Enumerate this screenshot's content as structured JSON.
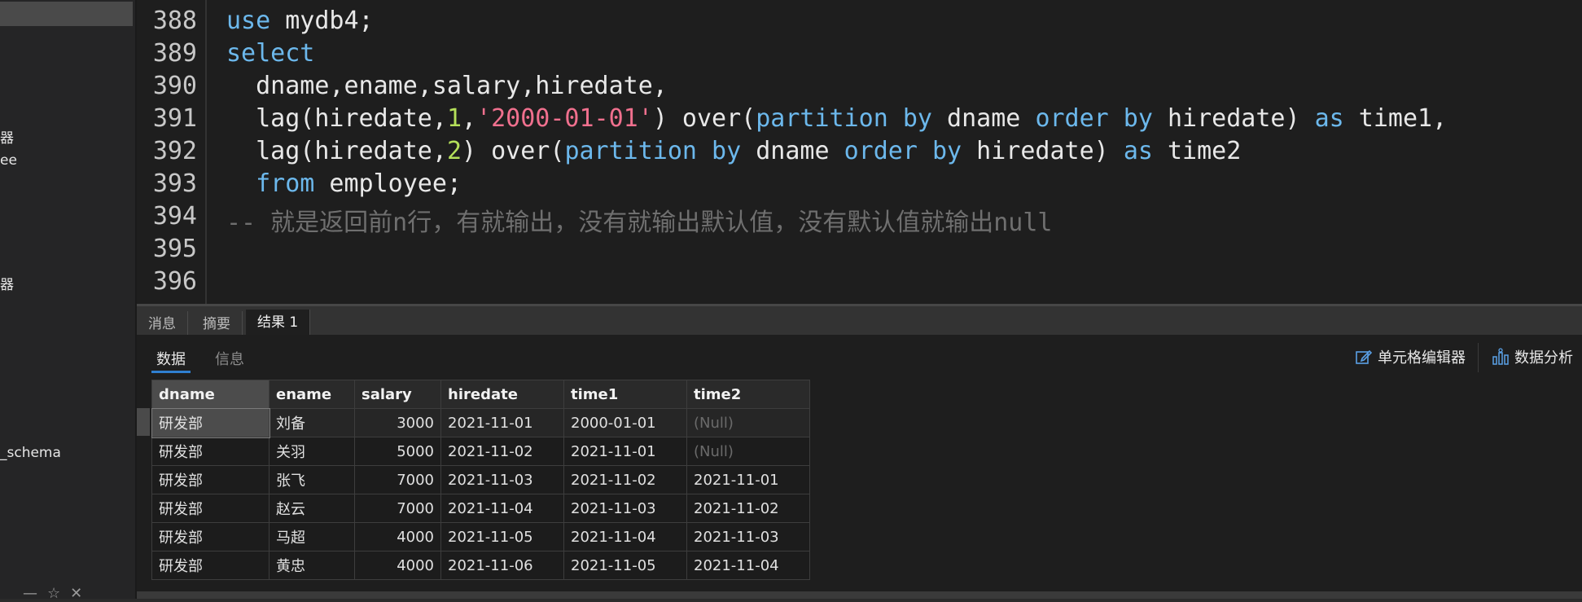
{
  "sidebar": {
    "fragments": [
      "器",
      "ee",
      "器",
      "_schema"
    ],
    "bottom_icons": [
      "minus-icon",
      "star-icon",
      "close-icon"
    ]
  },
  "editor": {
    "lines": [
      {
        "num": "388",
        "tokens": [
          [
            "kw",
            "use"
          ],
          [
            "t",
            " mydb4;"
          ]
        ]
      },
      {
        "num": "389",
        "tokens": [
          [
            "kw",
            "select"
          ]
        ]
      },
      {
        "num": "390",
        "tokens": [
          [
            "t",
            "  dname,ename,salary,hiredate,"
          ]
        ]
      },
      {
        "num": "391",
        "tokens": [
          [
            "t",
            "  lag(hiredate,"
          ],
          [
            "num",
            "1"
          ],
          [
            "t",
            ","
          ],
          [
            "str",
            "'2000-01-01'"
          ],
          [
            "t",
            ") over("
          ],
          [
            "kw",
            "partition by"
          ],
          [
            "t",
            " dname "
          ],
          [
            "kw",
            "order by"
          ],
          [
            "t",
            " hiredate) "
          ],
          [
            "kw",
            "as"
          ],
          [
            "t",
            " time1,"
          ]
        ]
      },
      {
        "num": "392",
        "tokens": [
          [
            "t",
            "  lag(hiredate,"
          ],
          [
            "num",
            "2"
          ],
          [
            "t",
            ") over("
          ],
          [
            "kw",
            "partition by"
          ],
          [
            "t",
            " dname "
          ],
          [
            "kw",
            "order by"
          ],
          [
            "t",
            " hiredate) "
          ],
          [
            "kw",
            "as"
          ],
          [
            "t",
            " time2"
          ]
        ]
      },
      {
        "num": "393",
        "tokens": [
          [
            "t",
            "  "
          ],
          [
            "kw",
            "from"
          ],
          [
            "t",
            " employee;"
          ]
        ]
      },
      {
        "num": "394",
        "tokens": [
          [
            "cmt",
            "-- 就是返回前n行，有就输出，没有就输出默认值，没有默认值就输出null"
          ]
        ]
      },
      {
        "num": "395",
        "tokens": []
      },
      {
        "num": "396",
        "tokens": []
      }
    ]
  },
  "result_tabs": [
    "消息",
    "摘要",
    "结果 1"
  ],
  "active_result_tab": "结果 1",
  "subtabs": {
    "data": "数据",
    "info": "信息"
  },
  "toolbar": {
    "cell_editor": "单元格编辑器",
    "data_analysis": "数据分析"
  },
  "grid": {
    "columns": [
      "dname",
      "ename",
      "salary",
      "hiredate",
      "time1",
      "time2"
    ],
    "rows": [
      [
        "研发部",
        "刘备",
        "3000",
        "2021-11-01",
        "2000-01-01",
        "(Null)"
      ],
      [
        "研发部",
        "关羽",
        "5000",
        "2021-11-02",
        "2021-11-01",
        "(Null)"
      ],
      [
        "研发部",
        "张飞",
        "7000",
        "2021-11-03",
        "2021-11-02",
        "2021-11-01"
      ],
      [
        "研发部",
        "赵云",
        "7000",
        "2021-11-04",
        "2021-11-03",
        "2021-11-02"
      ],
      [
        "研发部",
        "马超",
        "4000",
        "2021-11-05",
        "2021-11-04",
        "2021-11-03"
      ],
      [
        "研发部",
        "黄忠",
        "4000",
        "2021-11-06",
        "2021-11-05",
        "2021-11-04"
      ]
    ]
  },
  "colors": {
    "keyword": "#6cb8ec",
    "number": "#b5e05a",
    "string": "#f0708e",
    "comment": "#6f6f6f",
    "accent": "#2f7fd0"
  }
}
